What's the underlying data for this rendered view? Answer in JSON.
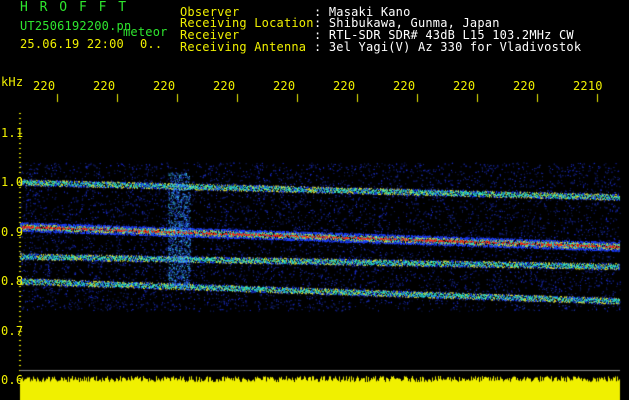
{
  "header": {
    "app_title": "H R O F F T",
    "filename": "UT2506192200.pn",
    "mode": "meteor",
    "datetime": "25.06.19 22:00",
    "counter": "0..",
    "fields": [
      {
        "label": "Observer",
        "value": ": Masaki Kano"
      },
      {
        "label": "Receiving Location",
        "value": ": Shibukawa, Gunma, Japan"
      },
      {
        "label": "Receiver",
        "value": ": RTL-SDR SDR# 43dB L15 103.2MHz CW"
      },
      {
        "label": "Receiving Antenna",
        "value": ": 3el Yagi(V) Az 330 for Vladivostok"
      }
    ]
  },
  "chart_data": {
    "type": "heatmap",
    "ylabel": "kHz",
    "y_ticks": [
      "1.1",
      "1.0",
      "0.9",
      "0.8",
      "0.7",
      "0.6"
    ],
    "x_ticks": [
      "220",
      "220",
      "220",
      "220",
      "220",
      "220",
      "220",
      "220",
      "220",
      "2210"
    ],
    "ylim": [
      0.6,
      1.15
    ],
    "echo_bands": [
      {
        "start": 1.0,
        "end": 0.97
      },
      {
        "start": 0.91,
        "end": 0.87
      },
      {
        "start": 0.85,
        "end": 0.83
      },
      {
        "start": 0.8,
        "end": 0.76
      }
    ],
    "signal_strip": "yellow"
  },
  "colors": {
    "background": "#000000",
    "text_yellow": "#f0f000",
    "text_green": "#2ee62e",
    "band_blue": "#1a3cff",
    "band_core": "#ff2a1a"
  }
}
